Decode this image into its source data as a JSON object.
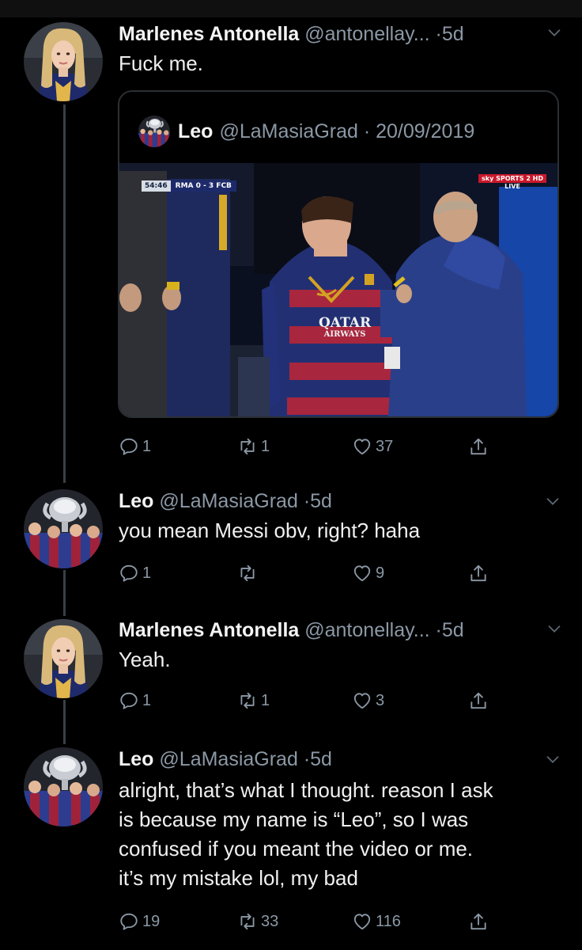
{
  "colors": {
    "background": "#000000",
    "muted_text": "#8b98a5",
    "thread_line": "#3a3f45",
    "quote_border": "#2b2f33"
  },
  "tweets": [
    {
      "name": "Marlenes Antonella",
      "handle": "@antonellay...",
      "separator": "·",
      "time": "5d",
      "text": "Fuck me.",
      "avatar_icon": "woman-avatar-icon",
      "quote": {
        "name": "Leo",
        "handle": "@LaMasiaGrad · 20/09/2019",
        "media": {
          "scorebug_clock": "54:46",
          "scorebug_score": "RMA 0 - 3 FCB",
          "broadcast_logo": "sky SPORTS 2 HD",
          "broadcast_sub": "LIVE",
          "sponsor_line1": "QATAR",
          "sponsor_line2": "AIRWAYS"
        }
      },
      "replies": "1",
      "retweets": "1",
      "likes": "37"
    },
    {
      "name": "Leo",
      "handle": "@LaMasiaGrad",
      "separator": "·",
      "time": "5d",
      "text": "you mean Messi obv, right? haha",
      "avatar_icon": "trophy-team-avatar-icon",
      "replies": "1",
      "retweets": "",
      "likes": "9"
    },
    {
      "name": "Marlenes Antonella",
      "handle": "@antonellay...",
      "separator": "·",
      "time": "5d",
      "text": "Yeah.",
      "avatar_icon": "woman-avatar-icon",
      "replies": "1",
      "retweets": "1",
      "likes": "3"
    },
    {
      "name": "Leo",
      "handle": "@LaMasiaGrad",
      "separator": "·",
      "time": "5d",
      "text_lines": [
        "alright, that’s what I thought. reason I ask",
        "is because my name is “Leo”, so I was",
        "confused if you meant the video or me.",
        "it’s my mistake lol, my bad"
      ],
      "avatar_icon": "trophy-team-avatar-icon",
      "replies": "19",
      "retweets": "33",
      "likes": "116"
    }
  ]
}
